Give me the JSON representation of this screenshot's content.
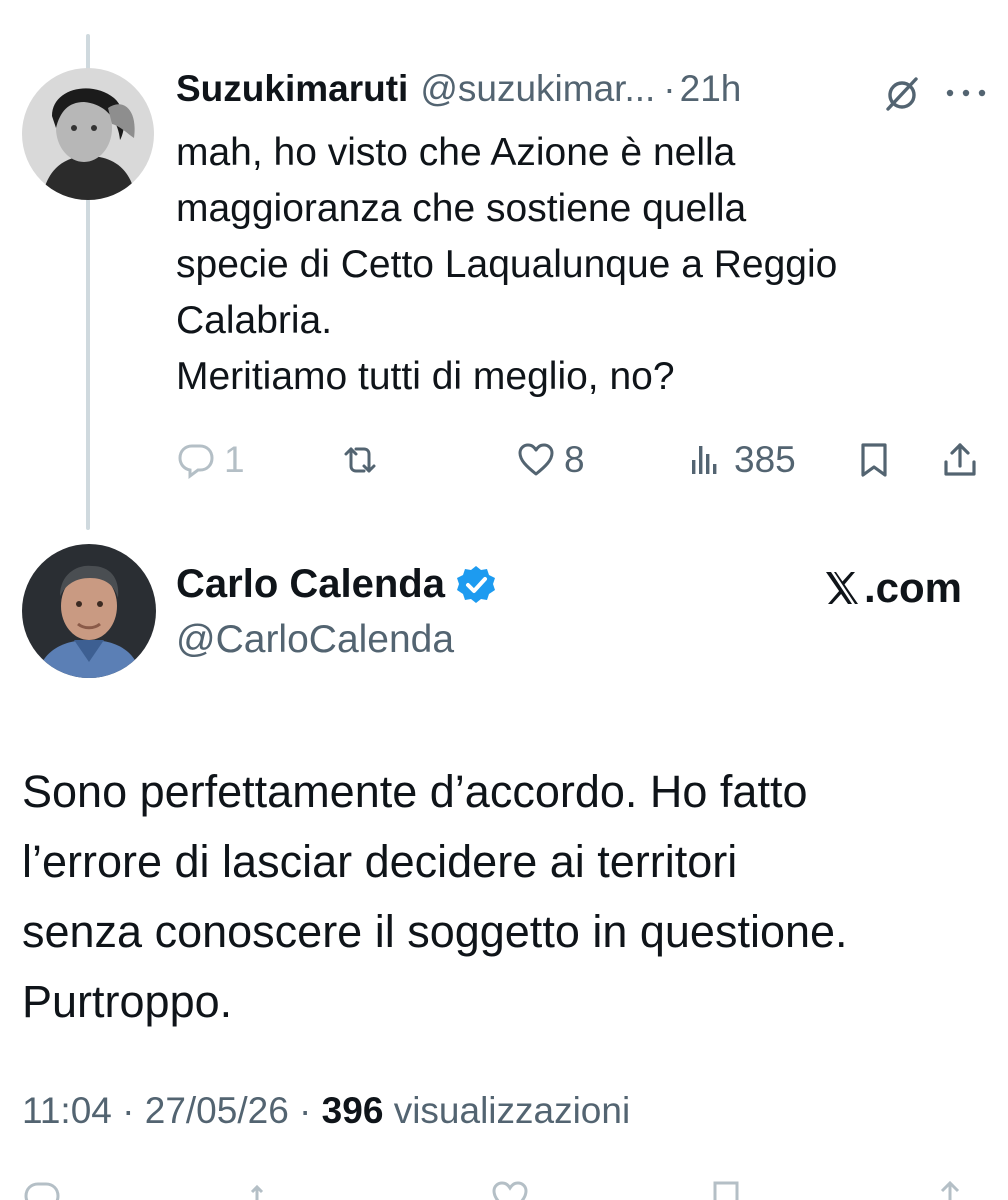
{
  "reply": {
    "author_name": "Suzukimaruti",
    "author_handle": "@suzukimar...",
    "separator": "·",
    "time": "21h",
    "text_lines": [
      "mah, ho visto che Azione è nella",
      "maggioranza che sostiene quella",
      "specie di Cetto Laqualunque a Reggio",
      "Calabria.",
      "Meritiamo tutti di meglio, no?"
    ],
    "actions": {
      "replies": "1",
      "retweets": "",
      "likes": "8",
      "views": "385"
    },
    "icons": [
      "grok-icon",
      "more-icon",
      "reply-icon",
      "retweet-icon",
      "like-icon",
      "views-icon",
      "bookmark-icon",
      "share-icon"
    ]
  },
  "main": {
    "author_name": "Carlo Calenda",
    "author_handle": "@CarloCalenda",
    "source_label": ".com",
    "text_lines": [
      "Sono perfettamente d’accordo. Ho fatto",
      "l’errore di lasciar decidere ai territori",
      "senza conoscere il soggetto in questione.",
      "Purtroppo."
    ],
    "time": "11:04",
    "date": "27/05/26",
    "separator": " · ",
    "view_count": "396",
    "views_label": "visualizzazioni",
    "icons": [
      "verified-badge-icon",
      "x-logo-icon"
    ]
  },
  "colors": {
    "text": "#0f1419",
    "secondary": "#536471",
    "thread_line": "#cfd9de",
    "verified_blue": "#1d9bf0"
  }
}
